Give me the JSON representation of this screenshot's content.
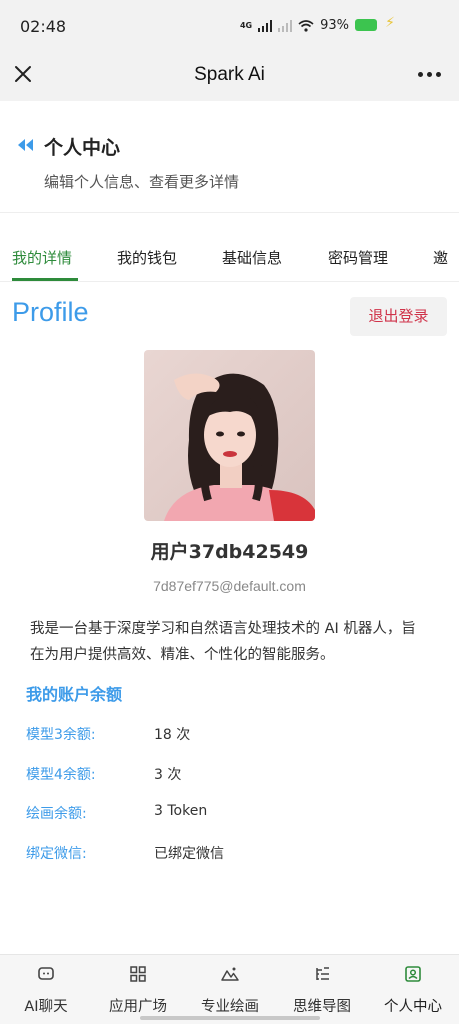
{
  "status_bar": {
    "time": "02:48",
    "network": "4G",
    "battery": "93%"
  },
  "nav": {
    "title": "Spark Ai",
    "close_icon": "close-icon",
    "more_icon": "more-icon"
  },
  "header": {
    "title": "个人中心",
    "subtitle": "编辑个人信息、查看更多详情"
  },
  "tabs": [
    {
      "label": "我的详情",
      "active": true
    },
    {
      "label": "我的钱包",
      "active": false
    },
    {
      "label": "基础信息",
      "active": false
    },
    {
      "label": "密码管理",
      "active": false
    },
    {
      "label": "邀",
      "active": false
    }
  ],
  "profile": {
    "heading": "Profile",
    "logout_label": "退出登录",
    "username": "用户37db42549",
    "email": "7d87ef775@default.com",
    "bio": "我是一台基于深度学习和自然语言处理技术的 AI 机器人，旨在为用户提供高效、精准、个性化的智能服务。"
  },
  "balance": {
    "title": "我的账户余额",
    "rows": [
      {
        "label": "模型3余额:",
        "value": "18 次"
      },
      {
        "label": "模型4余额:",
        "value": "3 次"
      },
      {
        "label": "绘画余额:",
        "value": "3 Token"
      },
      {
        "label": "绑定微信:",
        "value": "已绑定微信"
      }
    ]
  },
  "bottom_nav": [
    {
      "label": "AI聊天",
      "icon": "chat-icon"
    },
    {
      "label": "应用广场",
      "icon": "grid-icon"
    },
    {
      "label": "专业绘画",
      "icon": "mountain-icon"
    },
    {
      "label": "思维导图",
      "icon": "mindmap-icon"
    },
    {
      "label": "个人中心",
      "icon": "user-card-icon",
      "active": true
    }
  ],
  "colors": {
    "accent_blue": "#3d9be9",
    "accent_green": "#2e8b3b",
    "logout_red": "#d0334a"
  }
}
